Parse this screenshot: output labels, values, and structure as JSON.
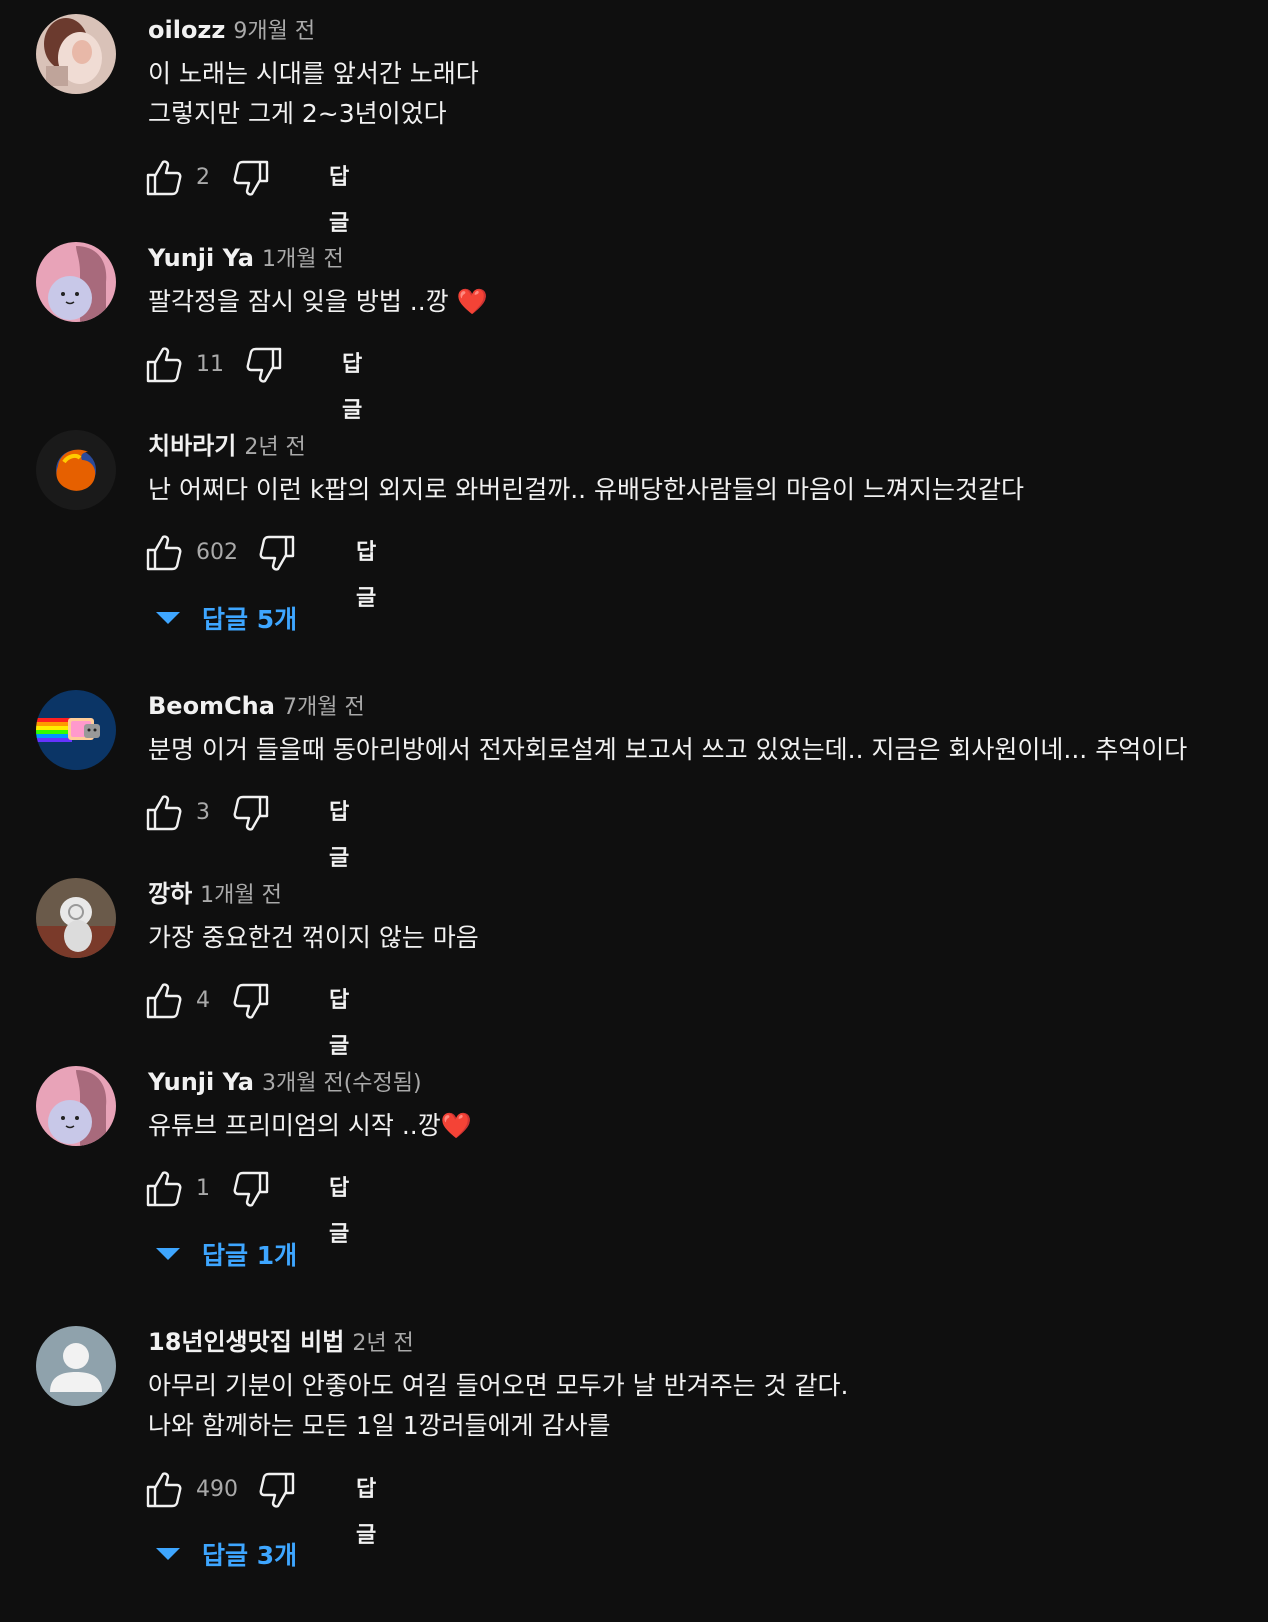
{
  "comments": [
    {
      "author": "oilozz",
      "time": "9개월 전",
      "lines": [
        "이 노래는 시대를 앞서간 노래다",
        "그렇지만 그게 2~3년이었다"
      ],
      "likes": "2",
      "reply_label": "답글",
      "avatar_icon": "photo-avatar-icon"
    },
    {
      "author": "Yunji Ya",
      "time": "1개월 전",
      "lines": [
        "팔각정을 잠시 잊을 방법 ..깡 ❤️"
      ],
      "likes": "11",
      "reply_label": "답글",
      "avatar_icon": "character-avatar-icon"
    },
    {
      "author": "치바라기",
      "time": "2년 전",
      "lines": [
        "난 어쩌다 이런 k팝의 외지로 와버린걸까.. 유배당한사람들의  마음이 느껴지는것같다"
      ],
      "likes": "602",
      "reply_label": "답글",
      "replies_label": "답글 5개",
      "avatar_icon": "firefox-avatar-icon"
    },
    {
      "author": "BeomCha",
      "time": "7개월 전",
      "lines": [
        "분명 이거 들을때 동아리방에서 전자회로설계 보고서 쓰고 있었는데.. 지금은 회사원이네... 추억이다"
      ],
      "likes": "3",
      "reply_label": "답글",
      "avatar_icon": "nyan-cat-avatar-icon"
    },
    {
      "author": "깡하",
      "time": "1개월 전",
      "lines": [
        "가장 중요한건 꺾이지 않는 마음"
      ],
      "likes": "4",
      "reply_label": "답글",
      "avatar_icon": "cat-photo-avatar-icon"
    },
    {
      "author": "Yunji Ya",
      "time": "3개월 전(수정됨)",
      "lines": [
        "유튜브 프리미엄의 시작 ..깡❤️"
      ],
      "likes": "1",
      "reply_label": "답글",
      "replies_label": "답글 1개",
      "avatar_icon": "character-avatar-icon"
    },
    {
      "author": "18년인생맛집 비법",
      "time": "2년 전",
      "lines": [
        "아무리 기분이 안좋아도 여길 들어오면 모두가 날 반겨주는 것 같다.",
        "나와 함께하는 모든 1일 1깡러들에게 감사를"
      ],
      "likes": "490",
      "reply_label": "답글",
      "replies_label": "답글 3개",
      "avatar_icon": "default-person-avatar-icon"
    }
  ],
  "colors": {
    "background": "#0f0f0f",
    "text": "#f1f1f1",
    "secondary_text": "#aaaaaa",
    "link_blue": "#3ea6ff"
  }
}
